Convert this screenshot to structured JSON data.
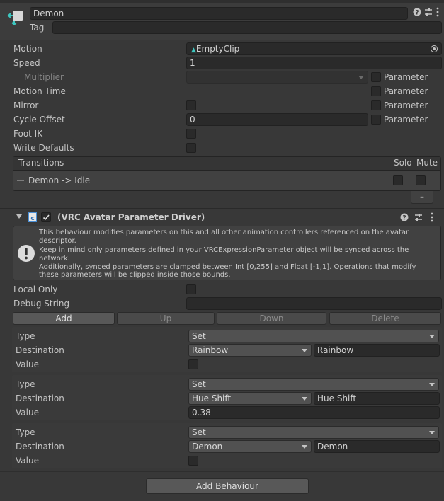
{
  "state": {
    "name": "Demon",
    "tag_label": "Tag",
    "tag_value": ""
  },
  "props": {
    "motion_label": "Motion",
    "motion_value": "EmptyClip",
    "speed_label": "Speed",
    "speed_value": "1",
    "multiplier_label": "Multiplier",
    "motion_time_label": "Motion Time",
    "mirror_label": "Mirror",
    "cycle_offset_label": "Cycle Offset",
    "cycle_offset_value": "0",
    "foot_ik_label": "Foot IK",
    "write_defaults_label": "Write Defaults",
    "parameter_label": "Parameter"
  },
  "transitions": {
    "header": "Transitions",
    "solo": "Solo",
    "mute": "Mute",
    "items": [
      "Demon -> Idle"
    ],
    "remove_label": "–"
  },
  "driver": {
    "title": "(VRC Avatar Parameter Driver)",
    "info_1": "This behaviour modifies parameters on this and all other animation controllers referenced on the avatar descriptor.",
    "info_2": "Keep in mind only parameters defined in your VRCExpressionParameter object will be synced across the network.",
    "info_3": "Additionally, synced parameters are clamped between Int [0,255] and Float [-1,1]. Operations that modify these parameters will be clipped inside those bounds.",
    "local_only_label": "Local Only",
    "debug_string_label": "Debug String",
    "debug_string_value": "",
    "buttons": {
      "add": "Add",
      "up": "Up",
      "down": "Down",
      "delete": "Delete"
    },
    "labels": {
      "type": "Type",
      "destination": "Destination",
      "value": "Value"
    },
    "entries": [
      {
        "type": "Set",
        "destination": "Rainbow",
        "destination_text": "Rainbow",
        "value": ""
      },
      {
        "type": "Set",
        "destination": "Hue Shift",
        "destination_text": "Hue Shift",
        "value": "0.38"
      },
      {
        "type": "Set",
        "destination": "Demon",
        "destination_text": "Demon",
        "value": ""
      }
    ]
  },
  "footer": {
    "add_behaviour": "Add Behaviour"
  },
  "colors": {
    "background": "#383838",
    "field": "#2a2a2a",
    "accent": "#3dc7c0"
  }
}
